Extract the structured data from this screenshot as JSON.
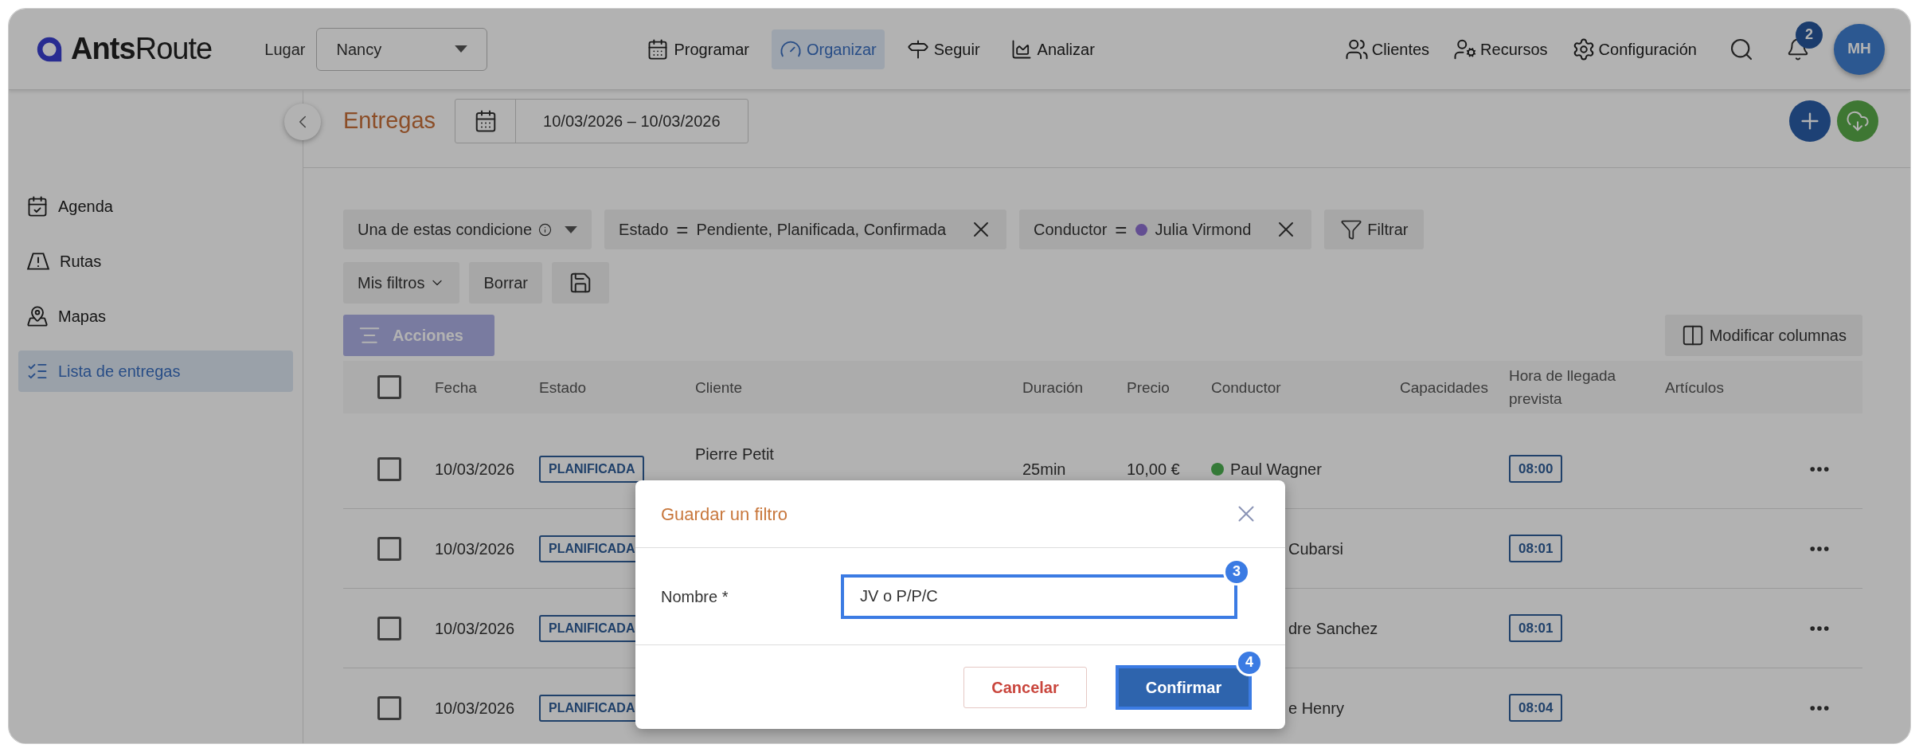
{
  "header": {
    "logo": "**Ants**Route",
    "place_label": "Lugar",
    "place_value": "Nancy",
    "nav": [
      {
        "label": "Programar",
        "selected": false
      },
      {
        "label": "Organizar",
        "selected": true
      },
      {
        "label": "Seguir",
        "selected": false
      },
      {
        "label": "Analizar",
        "selected": false
      }
    ],
    "tools": [
      "Clientes",
      "Recursos",
      "Configuración"
    ],
    "notifications": "2",
    "avatar": "MH"
  },
  "subheader": {
    "title": "Entregas",
    "date_range": "10/03/2026 – 10/03/2026"
  },
  "sidebar": {
    "items": [
      {
        "label": "Agenda",
        "selected": false
      },
      {
        "label": "Rutas",
        "selected": false
      },
      {
        "label": "Mapas",
        "selected": false
      },
      {
        "label": "Lista de entregas",
        "selected": true
      }
    ]
  },
  "filters": {
    "mode": "Una de estas condicione",
    "chips": [
      {
        "field": "Estado",
        "operator": "=",
        "value": "Pendiente, Planificada, Confirmada"
      },
      {
        "field": "Conductor",
        "operator": "=",
        "value": "Julia Virmond",
        "color": "#634e92"
      }
    ],
    "filter_button": "Filtrar",
    "my_filters": "Mis filtros",
    "clear": "Borrar"
  },
  "actions": {
    "label": "Acciones",
    "disabled": true
  },
  "columns_button": "Modificar columnas",
  "table": {
    "select_all_checked": false,
    "columns": [
      "Fecha",
      "Estado",
      "Cliente",
      "Duración",
      "Precio",
      "Conductor",
      "Capacidades",
      "Hora de llegada prevista",
      "Artículos"
    ],
    "rows": [
      {
        "checked": false,
        "date": "10/03/2026",
        "status": "PLANIFICADA",
        "client": "Pierre Petit",
        "duration": "25min",
        "price": "10,00 €",
        "driver": {
          "name": "Paul Wagner",
          "color": "#357a38"
        },
        "eta": "08:00"
      },
      {
        "checked": false,
        "date": "10/03/2026",
        "status": "PLANIFICADA",
        "driver": {
          "name": "Cubarsi"
        },
        "eta": "08:01"
      },
      {
        "checked": false,
        "date": "10/03/2026",
        "status": "PLANIFICADA",
        "driver": {
          "name": "dre Sanchez"
        },
        "eta": "08:01"
      },
      {
        "checked": false,
        "date": "10/03/2026",
        "status": "PLANIFICADA",
        "driver": {
          "name": "e Henry"
        },
        "eta": "08:04"
      }
    ]
  },
  "modal": {
    "title": "Guardar un filtro",
    "field_label": "Nombre *",
    "field_value": "JV o P/P/C",
    "field_step": "3",
    "cancel": "Cancelar",
    "confirm": "Confirmar",
    "confirm_step": "4"
  }
}
